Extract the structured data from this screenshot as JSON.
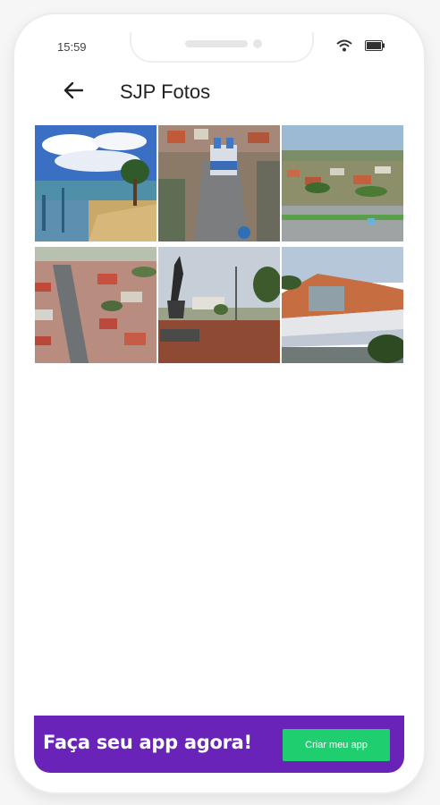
{
  "status_bar": {
    "time": "15:59",
    "icons": [
      "wifi-icon",
      "battery-icon"
    ]
  },
  "app_bar": {
    "title": "SJP Fotos",
    "back_icon": "arrow-left-icon"
  },
  "gallery": {
    "photos": [
      {
        "subject": "reservoir-park-photo"
      },
      {
        "subject": "church-square-aerial-photo"
      },
      {
        "subject": "town-overview-photo"
      },
      {
        "subject": "town-aerial-photo"
      },
      {
        "subject": "monument-statue-photo"
      },
      {
        "subject": "dam-spillway-photo"
      }
    ]
  },
  "banner": {
    "text": "Faça seu app agora!",
    "button_label": "Criar meu app",
    "background_color": "#6a23b8",
    "button_color": "#1fcf6f"
  }
}
